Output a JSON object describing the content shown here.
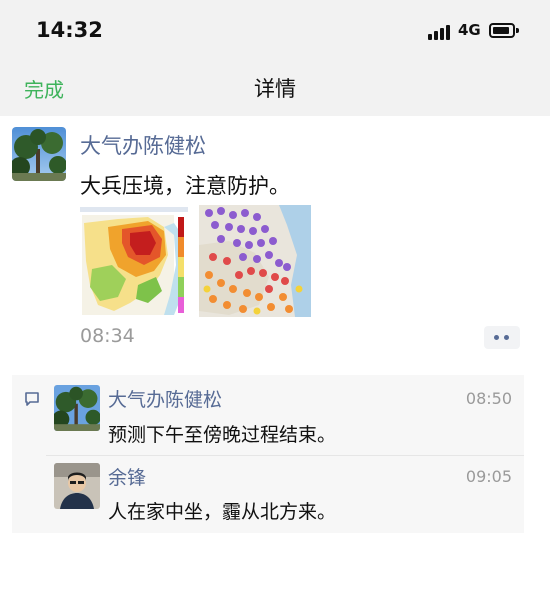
{
  "status_bar": {
    "time": "14:32",
    "network": "4G"
  },
  "nav": {
    "done_label": "完成",
    "title": "详情"
  },
  "post": {
    "author": "大气办陈健松",
    "text": "大兵压境，注意防护。",
    "time": "08:34",
    "images": [
      "air-quality-forecast-map",
      "aqi-station-map"
    ]
  },
  "comments": [
    {
      "author": "大气办陈健松",
      "text": "预测下午至傍晚过程结束。",
      "time": "08:50"
    },
    {
      "author": "余锋",
      "text": "人在家中坐，霾从北方来。",
      "time": "09:05"
    }
  ],
  "colors": {
    "accent_green": "#3eb35b",
    "link_blue": "#576b95",
    "meta_gray": "#9a9a9a"
  }
}
